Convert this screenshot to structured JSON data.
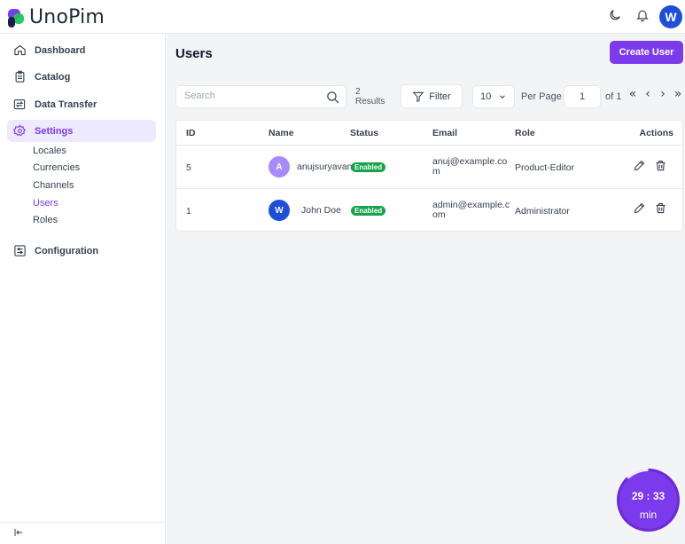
{
  "app": {
    "brand": "UnoPim",
    "accent": "#7c3aed"
  },
  "header": {
    "theme_icon": "moon-icon",
    "notifications_icon": "bell-icon",
    "avatar_label": "W"
  },
  "sidebar": {
    "items": [
      {
        "label": "Dashboard",
        "icon": "home-icon"
      },
      {
        "label": "Catalog",
        "icon": "clipboard-icon"
      },
      {
        "label": "Data Transfer",
        "icon": "transfer-icon"
      },
      {
        "label": "Settings",
        "icon": "gear-icon",
        "active": true
      },
      {
        "label": "Configuration",
        "icon": "sliders-icon"
      }
    ],
    "settings_sub": [
      {
        "label": "Locales"
      },
      {
        "label": "Currencies"
      },
      {
        "label": "Channels"
      },
      {
        "label": "Users",
        "active": true
      },
      {
        "label": "Roles"
      }
    ]
  },
  "page": {
    "title": "Users",
    "create_label": "Create User"
  },
  "toolbar": {
    "search_placeholder": "Search",
    "results_count": "2",
    "results_label": "Results",
    "filter_label": "Filter",
    "per_page_value": "10",
    "per_page_label": "Per Page",
    "page_value": "1",
    "of_label": "of 1",
    "first_glyph": "«",
    "prev_glyph": "‹",
    "next_glyph": "›",
    "last_glyph": "»"
  },
  "table": {
    "columns": [
      "ID",
      "Name",
      "Status",
      "Email",
      "Role",
      "Actions"
    ],
    "rows": [
      {
        "id": "5",
        "avatar": "A",
        "avatar_color": "#a78bfa",
        "name": "anujsuryavanshi",
        "status": "Enabled",
        "email_l1": "anuj@example.co",
        "email_l2": "m",
        "role": "Product-Editor"
      },
      {
        "id": "1",
        "avatar": "W",
        "avatar_color": "#1d4fd8",
        "name": "John Doe",
        "status": "Enabled",
        "email_l1": "admin@example.c",
        "email_l2": "om",
        "role": "Administrator"
      }
    ]
  },
  "timer": {
    "time": "29 : 33",
    "unit": "min"
  }
}
